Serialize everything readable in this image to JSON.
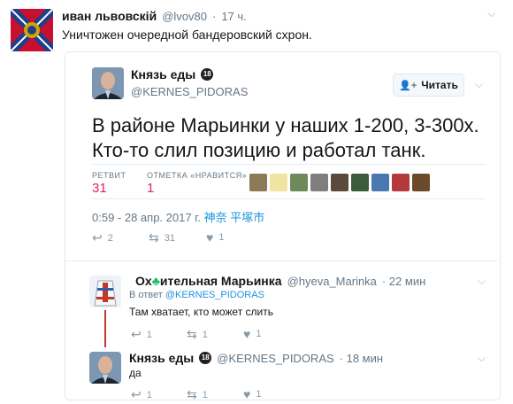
{
  "tweet": {
    "author_name": "иван львовскій",
    "author_handle": "@lvov80",
    "time": "17 ч.",
    "text": "Уничтожен очередной бандеровский схрон."
  },
  "quoted": {
    "author_name": "Князь еды",
    "author_badge": "18",
    "author_handle": "@KERNES_PIDORAS",
    "follow_label": "Читать",
    "text_line1": "В районе Марьинки у наших 1-200, 3-300х.",
    "text_line2": "Кто-то слил позицию и работал танк.",
    "retweets_label": "РЕТВИТ",
    "retweets_value": "31",
    "likes_label": "ОТМЕТКА «НРАВИТСЯ»",
    "likes_value": "1",
    "timestamp": "0:59 - 28 апр. 2017 г.",
    "location": "神奈 平塚市",
    "actions": {
      "replies": "2",
      "retweets": "31",
      "likes": "1"
    }
  },
  "reply1": {
    "author_name_prefix": "Ох",
    "author_name_suffix": "ительная Марьинка",
    "author_handle": "@hyeva_Marinka",
    "time": "· 22 мин",
    "reply_to_label": "В ответ",
    "reply_to_handle": "@KERNES_PIDORAS",
    "text": "Там хватает, кто может слить",
    "actions": {
      "replies": "1",
      "retweets": "1",
      "likes": "1"
    }
  },
  "reply2": {
    "author_name": "Князь еды",
    "author_badge": "18",
    "author_handle": "@KERNES_PIDORAS",
    "time": "· 18 мин",
    "text": "да",
    "actions": {
      "replies": "1",
      "retweets": "1",
      "likes": "1"
    }
  },
  "colors": {
    "accent": "#1b95e0",
    "like": "#e0245e",
    "muted": "#657786"
  },
  "icons": {
    "reply": "reply-icon",
    "retweet": "retweet-icon",
    "like": "heart-icon",
    "caret": "chevron-down-icon",
    "follow": "follow-person-icon"
  }
}
